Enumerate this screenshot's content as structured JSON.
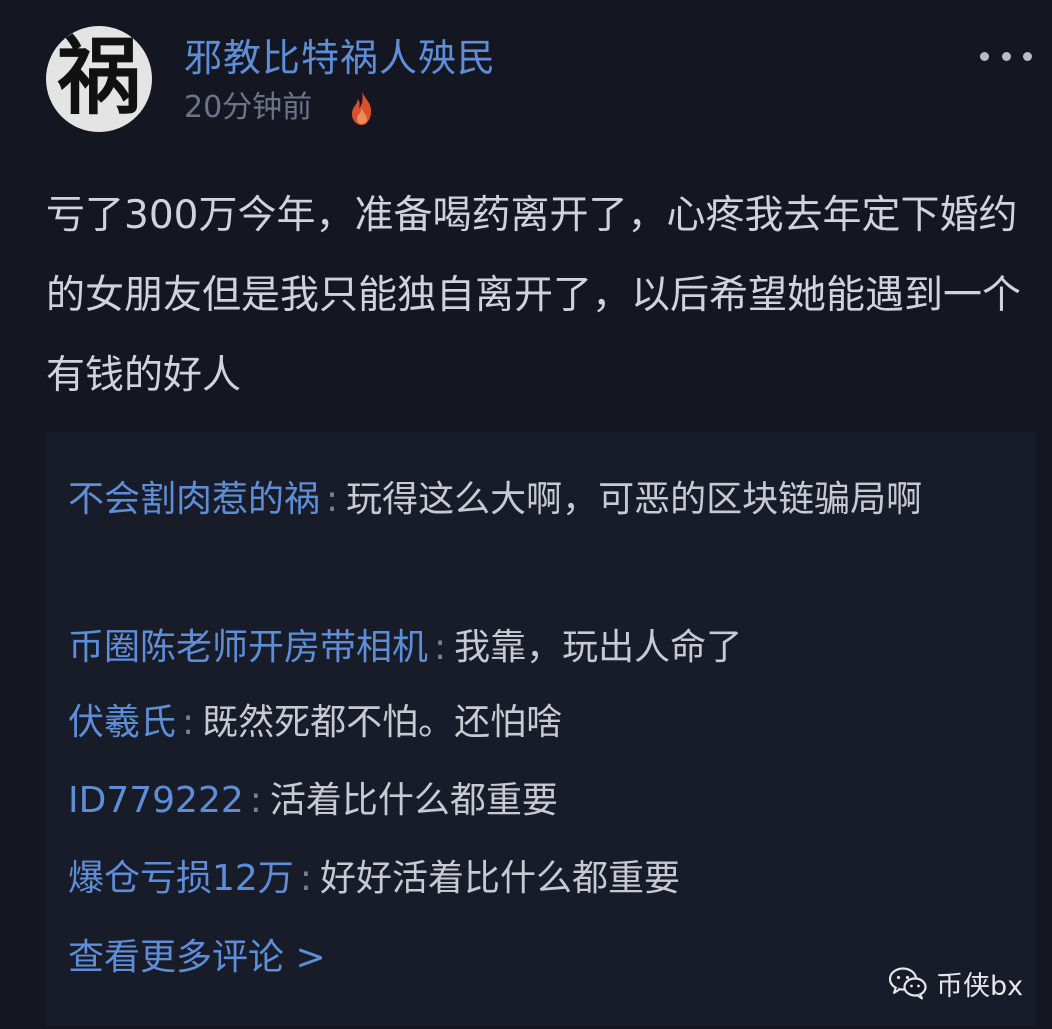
{
  "post": {
    "avatar_char": "祸",
    "username": "邪教比特祸人殃民",
    "time": "20分钟前",
    "hot_icon": "fire-icon",
    "more_icon": "more-dots-icon",
    "content": "亏了300万今年，准备喝药离开了，心疼我去年定下婚约的女朋友但是我只能独自离开了，以后希望她能遇到一个有钱的好人"
  },
  "comments": [
    {
      "name": "不会割肉惹的祸",
      "separator": ":",
      "text": "玩得这么大啊，可恶的区块链骗局啊"
    },
    {
      "name": "币圈陈老师开房带相机",
      "separator": ":",
      "text": "我靠，玩出人命了"
    },
    {
      "name": "伏羲氏",
      "separator": ":",
      "text": "既然死都不怕。还怕啥"
    },
    {
      "name": "ID779222",
      "separator": ":",
      "text": "活着比什么都重要"
    },
    {
      "name": "爆仓亏损12万",
      "separator": ":",
      "text": "好好活着比什么都重要"
    }
  ],
  "view_more": "查看更多评论 >",
  "watermark": {
    "icon": "wechat-icon",
    "text": "币侠bx"
  },
  "colors": {
    "background": "#141722",
    "link_blue": "#5f8ed8",
    "body_text": "#d0d3dc",
    "muted_text": "#6f7484"
  }
}
